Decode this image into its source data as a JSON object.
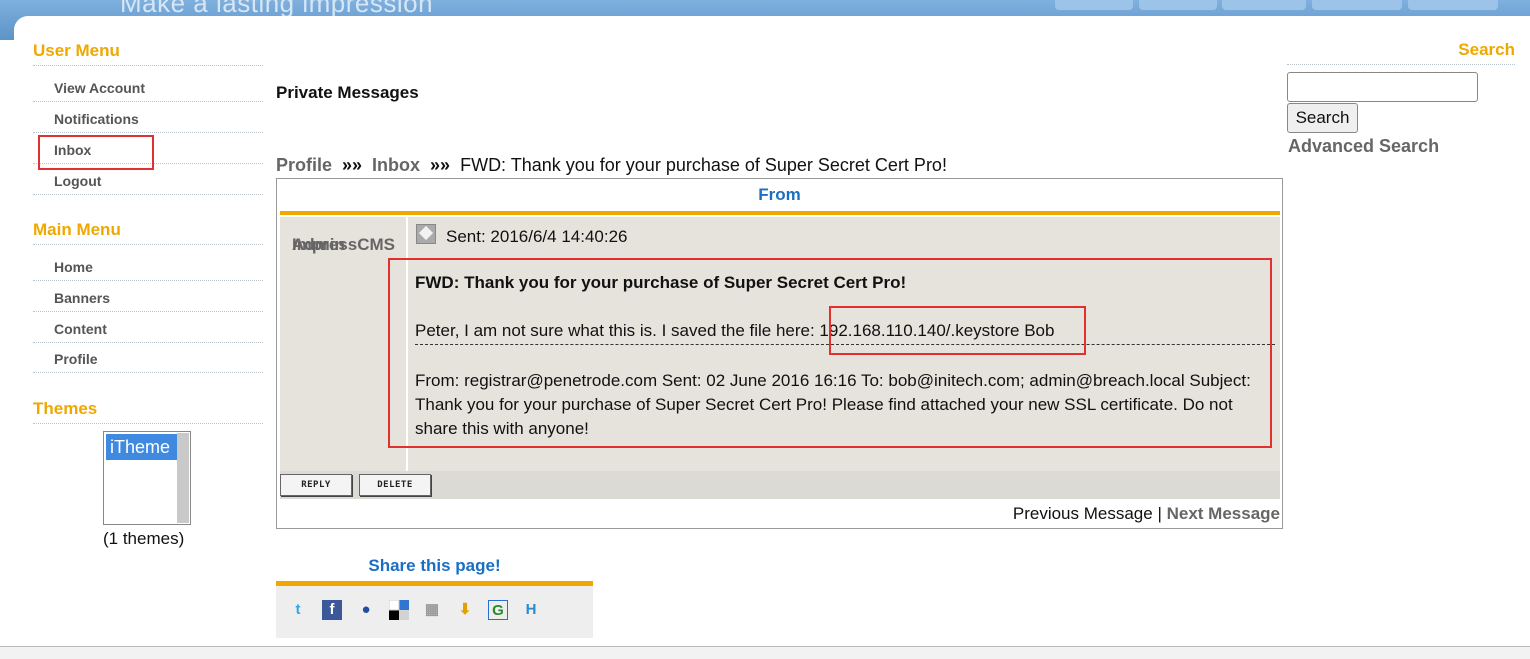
{
  "header": {
    "slogan": "Make a lasting impression"
  },
  "user_menu": {
    "title": "User Menu",
    "items": [
      "View Account",
      "Notifications",
      "Inbox",
      "Logout"
    ]
  },
  "main_menu": {
    "title": "Main Menu",
    "items": [
      "Home",
      "Banners",
      "Content",
      "Profile"
    ]
  },
  "themes": {
    "title": "Themes",
    "selected": "iTheme",
    "count": "(1 themes)"
  },
  "content": {
    "page_title": "Private Messages",
    "breadcrumb": {
      "profile": "Profile",
      "sep": "»»",
      "inbox": "Inbox",
      "current": "FWD: Thank you for your purchase of Super Secret Cert Pro!"
    },
    "table": {
      "from_header": "From",
      "author_line1": "ImpressCMS",
      "author_line2": "Admin",
      "sent": "Sent: 2016/6/4 14:40:26",
      "subject": "FWD: Thank you for your purchase of Super Secret Cert Pro!",
      "body_line1": "Peter, I am not sure what this is. I saved the file here: 192.168.110.140/.keystore Bob",
      "forwarded": "From: registrar@penetrode.com Sent: 02 June 2016 16:16 To: bob@initech.com; admin@breach.local Subject: Thank you for your purchase of Super Secret Cert Pro! Please find attached your new SSL certificate. Do not share this with anyone!",
      "reply_label": "REPLY",
      "delete_label": "DELETE",
      "prev": "Previous Message",
      "divider": "|",
      "next": "Next Message"
    },
    "share": {
      "title": "Share this page!",
      "icons": [
        "twitter-icon",
        "facebook-icon",
        "myspace-icon",
        "delicious-icon",
        "digg-icon",
        "download-icon",
        "google-icon",
        "hatena-icon"
      ]
    }
  },
  "search": {
    "title": "Search",
    "input_value": "",
    "button": "Search",
    "advanced": "Advanced Search"
  },
  "colors": {
    "accent": "#f0a800",
    "link_blue": "#1a6fc2",
    "highlight_red": "#e03030",
    "cell_bg": "#e6e3dc"
  }
}
